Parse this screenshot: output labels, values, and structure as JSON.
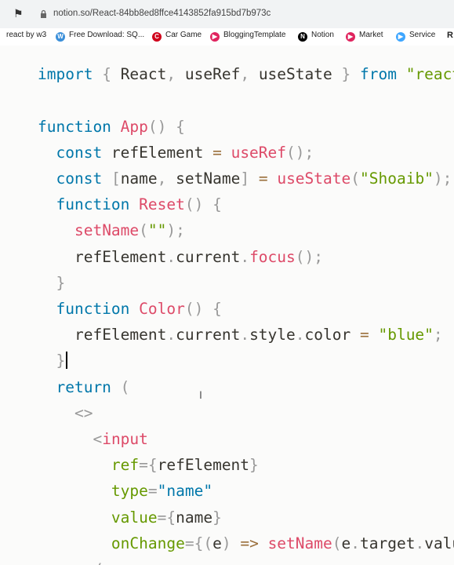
{
  "browser": {
    "url": "notion.so/React-84bb8ed8ffce4143852fa915bd7b973c",
    "bookmarks": [
      {
        "label": "react by w3",
        "icon": "bookmark-icon",
        "color": "#555555"
      },
      {
        "label": "Free Download: SQ...",
        "icon": "w-logo-icon",
        "color": "#3b8fd9"
      },
      {
        "label": "Car Game",
        "icon": "cr-logo-icon",
        "color": "#d0021b"
      },
      {
        "label": "BloggingTemplate",
        "icon": "play-logo-icon",
        "color": "#e0245e"
      },
      {
        "label": "Notion",
        "icon": "notion-logo-icon",
        "color": "#000000"
      },
      {
        "label": "Market",
        "icon": "play-logo-icon",
        "color": "#e0245e"
      },
      {
        "label": "Service",
        "icon": "play-arrow-icon",
        "color": "#3ea6ff"
      },
      {
        "label": "R",
        "icon": "",
        "color": "#000000"
      }
    ]
  },
  "code": {
    "lines": [
      {
        "segs": [
          {
            "t": "  ",
            "c": "p"
          }
        ]
      },
      {
        "segs": [
          {
            "t": "import",
            "c": "k"
          },
          {
            "t": " { ",
            "c": "p"
          },
          {
            "t": "React",
            "c": ""
          },
          {
            "t": ", ",
            "c": "p"
          },
          {
            "t": "useRef",
            "c": ""
          },
          {
            "t": ", ",
            "c": "p"
          },
          {
            "t": "useState",
            "c": ""
          },
          {
            "t": " } ",
            "c": "p"
          },
          {
            "t": "from",
            "c": "k"
          },
          {
            "t": " ",
            "c": ""
          },
          {
            "t": "\"react\"",
            "c": "s"
          }
        ]
      },
      {
        "segs": []
      },
      {
        "segs": [
          {
            "t": "function",
            "c": "k"
          },
          {
            "t": " ",
            "c": ""
          },
          {
            "t": "App",
            "c": "f"
          },
          {
            "t": "() {",
            "c": "p"
          }
        ]
      },
      {
        "segs": [
          {
            "t": "  ",
            "c": ""
          },
          {
            "t": "const",
            "c": "k"
          },
          {
            "t": " refElement ",
            "c": ""
          },
          {
            "t": "=",
            "c": "o"
          },
          {
            "t": " ",
            "c": ""
          },
          {
            "t": "useRef",
            "c": "f"
          },
          {
            "t": "();",
            "c": "p"
          }
        ]
      },
      {
        "segs": [
          {
            "t": "  ",
            "c": ""
          },
          {
            "t": "const",
            "c": "k"
          },
          {
            "t": " ",
            "c": ""
          },
          {
            "t": "[",
            "c": "p"
          },
          {
            "t": "name",
            "c": ""
          },
          {
            "t": ", ",
            "c": "p"
          },
          {
            "t": "setName",
            "c": ""
          },
          {
            "t": "]",
            "c": "p"
          },
          {
            "t": " ",
            "c": ""
          },
          {
            "t": "=",
            "c": "o"
          },
          {
            "t": " ",
            "c": ""
          },
          {
            "t": "useState",
            "c": "f"
          },
          {
            "t": "(",
            "c": "p"
          },
          {
            "t": "\"Shoaib\"",
            "c": "s"
          },
          {
            "t": ");",
            "c": "p"
          }
        ]
      },
      {
        "segs": [
          {
            "t": "  ",
            "c": ""
          },
          {
            "t": "function",
            "c": "k"
          },
          {
            "t": " ",
            "c": ""
          },
          {
            "t": "Reset",
            "c": "f"
          },
          {
            "t": "() {",
            "c": "p"
          }
        ]
      },
      {
        "segs": [
          {
            "t": "    ",
            "c": ""
          },
          {
            "t": "setName",
            "c": "f"
          },
          {
            "t": "(",
            "c": "p"
          },
          {
            "t": "\"\"",
            "c": "s"
          },
          {
            "t": ");",
            "c": "p"
          }
        ]
      },
      {
        "segs": [
          {
            "t": "    ",
            "c": ""
          },
          {
            "t": "refElement",
            "c": ""
          },
          {
            "t": ".",
            "c": "p"
          },
          {
            "t": "current",
            "c": ""
          },
          {
            "t": ".",
            "c": "p"
          },
          {
            "t": "focus",
            "c": "f"
          },
          {
            "t": "();",
            "c": "p"
          }
        ]
      },
      {
        "segs": [
          {
            "t": "  ",
            "c": ""
          },
          {
            "t": "}",
            "c": "p"
          }
        ]
      },
      {
        "segs": [
          {
            "t": "  ",
            "c": ""
          },
          {
            "t": "function",
            "c": "k"
          },
          {
            "t": " ",
            "c": ""
          },
          {
            "t": "Color",
            "c": "f"
          },
          {
            "t": "() {",
            "c": "p"
          }
        ]
      },
      {
        "segs": [
          {
            "t": "    ",
            "c": ""
          },
          {
            "t": "refElement",
            "c": ""
          },
          {
            "t": ".",
            "c": "p"
          },
          {
            "t": "current",
            "c": ""
          },
          {
            "t": ".",
            "c": "p"
          },
          {
            "t": "style",
            "c": ""
          },
          {
            "t": ".",
            "c": "p"
          },
          {
            "t": "color",
            "c": ""
          },
          {
            "t": " ",
            "c": ""
          },
          {
            "t": "=",
            "c": "o"
          },
          {
            "t": " ",
            "c": ""
          },
          {
            "t": "\"blue\"",
            "c": "s"
          },
          {
            "t": ";",
            "c": "p"
          }
        ]
      },
      {
        "segs": [
          {
            "t": "  ",
            "c": ""
          },
          {
            "t": "}",
            "c": "p"
          }
        ],
        "caret": true
      },
      {
        "segs": [
          {
            "t": "  ",
            "c": ""
          },
          {
            "t": "return",
            "c": "k"
          },
          {
            "t": " (",
            "c": "p"
          }
        ]
      },
      {
        "segs": [
          {
            "t": "    ",
            "c": ""
          },
          {
            "t": "<>",
            "c": "tg"
          }
        ]
      },
      {
        "segs": [
          {
            "t": "      ",
            "c": ""
          },
          {
            "t": "<",
            "c": "tg"
          },
          {
            "t": "input",
            "c": "f"
          }
        ]
      },
      {
        "segs": [
          {
            "t": "        ",
            "c": ""
          },
          {
            "t": "ref",
            "c": "s"
          },
          {
            "t": "={",
            "c": "p"
          },
          {
            "t": "refElement",
            "c": ""
          },
          {
            "t": "}",
            "c": "p"
          }
        ]
      },
      {
        "segs": [
          {
            "t": "        ",
            "c": ""
          },
          {
            "t": "type",
            "c": "s"
          },
          {
            "t": "=",
            "c": "p"
          },
          {
            "t": "\"name\"",
            "c": "k"
          }
        ]
      },
      {
        "segs": [
          {
            "t": "        ",
            "c": ""
          },
          {
            "t": "value",
            "c": "s"
          },
          {
            "t": "={",
            "c": "p"
          },
          {
            "t": "name",
            "c": ""
          },
          {
            "t": "}",
            "c": "p"
          }
        ]
      },
      {
        "segs": [
          {
            "t": "        ",
            "c": ""
          },
          {
            "t": "onChange",
            "c": "s"
          },
          {
            "t": "={",
            "c": "p"
          },
          {
            "t": "(",
            "c": "p"
          },
          {
            "t": "e",
            "c": ""
          },
          {
            "t": ")",
            "c": "p"
          },
          {
            "t": " ",
            "c": ""
          },
          {
            "t": "=>",
            "c": "o"
          },
          {
            "t": " ",
            "c": ""
          },
          {
            "t": "setName",
            "c": "f"
          },
          {
            "t": "(",
            "c": "p"
          },
          {
            "t": "e",
            "c": ""
          },
          {
            "t": ".",
            "c": "p"
          },
          {
            "t": "target",
            "c": ""
          },
          {
            "t": ".",
            "c": "p"
          },
          {
            "t": "value",
            "c": ""
          },
          {
            "t": ")}",
            "c": "p"
          }
        ]
      },
      {
        "segs": [
          {
            "t": "      ",
            "c": ""
          },
          {
            "t": "/>",
            "c": "tg"
          }
        ]
      }
    ]
  }
}
